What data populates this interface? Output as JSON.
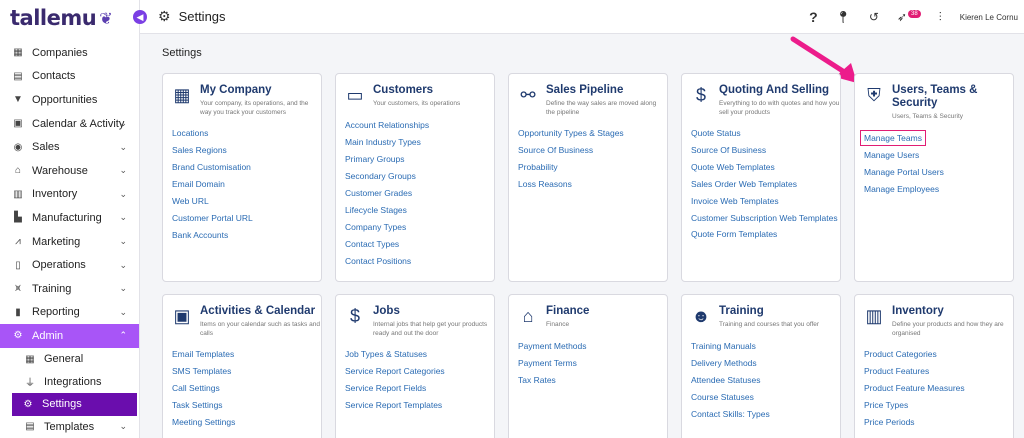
{
  "logo": {
    "text": "tallemu",
    "icon": "emu-bird-logo"
  },
  "sidebar": {
    "items": [
      {
        "label": "Companies",
        "icon": "building-icon",
        "has_chevron": false
      },
      {
        "label": "Contacts",
        "icon": "contact-card-icon",
        "has_chevron": false
      },
      {
        "label": "Opportunities",
        "icon": "funnel-icon",
        "has_chevron": false
      },
      {
        "label": "Calendar & Activity",
        "icon": "calendar-icon",
        "has_chevron": true
      },
      {
        "label": "Sales",
        "icon": "dollar-icon",
        "has_chevron": true
      },
      {
        "label": "Warehouse",
        "icon": "warehouse-icon",
        "has_chevron": true
      },
      {
        "label": "Inventory",
        "icon": "inventory-icon",
        "has_chevron": true
      },
      {
        "label": "Manufacturing",
        "icon": "factory-icon",
        "has_chevron": true
      },
      {
        "label": "Marketing",
        "icon": "chart-line-icon",
        "has_chevron": true
      },
      {
        "label": "Operations",
        "icon": "clipboard-icon",
        "has_chevron": true
      },
      {
        "label": "Training",
        "icon": "graduation-cap-icon",
        "has_chevron": true
      },
      {
        "label": "Reporting",
        "icon": "report-icon",
        "has_chevron": true
      },
      {
        "label": "Admin",
        "icon": "gear-icon",
        "has_chevron": true,
        "active": true
      }
    ],
    "admin_sub": [
      {
        "label": "General",
        "icon": "sliders-icon"
      },
      {
        "label": "Integrations",
        "icon": "plug-icon"
      },
      {
        "label": "Settings",
        "icon": "gears-icon",
        "selected": true
      },
      {
        "label": "Templates",
        "icon": "template-icon"
      }
    ]
  },
  "topbar": {
    "title": "Settings",
    "notification_count": "38",
    "username": "Kieren Le Cornu"
  },
  "main": {
    "heading": "Settings",
    "cards": [
      {
        "title": "My Company",
        "desc": "Your company, its operations, and the way you track your customers",
        "icon": "building-icon",
        "links": [
          "Locations",
          "Sales Regions",
          "Brand Customisation",
          "Email Domain",
          "Web URL",
          "Customer Portal URL",
          "Bank Accounts"
        ]
      },
      {
        "title": "Customers",
        "desc": "Your customers, its operations",
        "icon": "id-card-icon",
        "links": [
          "Account Relationships",
          "Main Industry Types",
          "Primary Groups",
          "Secondary Groups",
          "Customer Grades",
          "Lifecycle Stages",
          "Company Types",
          "Contact Types",
          "Contact Positions"
        ]
      },
      {
        "title": "Sales Pipeline",
        "desc": "Define the way sales are moved along the pipeline",
        "icon": "pipeline-icon",
        "links": [
          "Opportunity Types & Stages",
          "Source Of Business",
          "Probability",
          "Loss Reasons"
        ]
      },
      {
        "title": "Quoting And Selling",
        "desc": "Everything to do with quotes and how you sell your products",
        "icon": "dollar-circle-icon",
        "links": [
          "Quote Status",
          "Source Of Business",
          "Quote Web Templates",
          "Sales Order Web Templates",
          "Invoice Web Templates",
          "Customer Subscription Web Templates",
          "Quote Form Templates"
        ]
      },
      {
        "title": "Users, Teams & Security",
        "desc": "Users, Teams & Security",
        "icon": "user-shield-icon",
        "links": [
          "Manage Teams",
          "Manage Users",
          "Manage Portal Users",
          "Manage Employees"
        ]
      },
      {
        "title": "Activities & Calendar",
        "desc": "Items on your calendar such as tasks and calls",
        "icon": "calendar-icon",
        "links": [
          "Email Templates",
          "SMS Templates",
          "Call Settings",
          "Task Settings",
          "Meeting Settings"
        ]
      },
      {
        "title": "Jobs",
        "desc": "Internal jobs that help get your products ready and out the door",
        "icon": "job-dollar-icon",
        "links": [
          "Job Types & Statuses",
          "Service Report Categories",
          "Service Report Fields",
          "Service Report Templates"
        ]
      },
      {
        "title": "Finance",
        "desc": "Finance",
        "icon": "bank-icon",
        "links": [
          "Payment Methods",
          "Payment Terms",
          "Tax Rates"
        ]
      },
      {
        "title": "Training",
        "desc": "Training and courses that you offer",
        "icon": "head-lightbulb-icon",
        "links": [
          "Training Manuals",
          "Delivery Methods",
          "Attendee Statuses",
          "Course Statuses",
          "Contact Skills: Types"
        ]
      },
      {
        "title": "Inventory",
        "desc": "Define your products and how they are organised",
        "icon": "barcode-icon",
        "links": [
          "Product Categories",
          "Product Features",
          "Product Feature Measures",
          "Price Types",
          "Price Periods"
        ]
      }
    ]
  }
}
